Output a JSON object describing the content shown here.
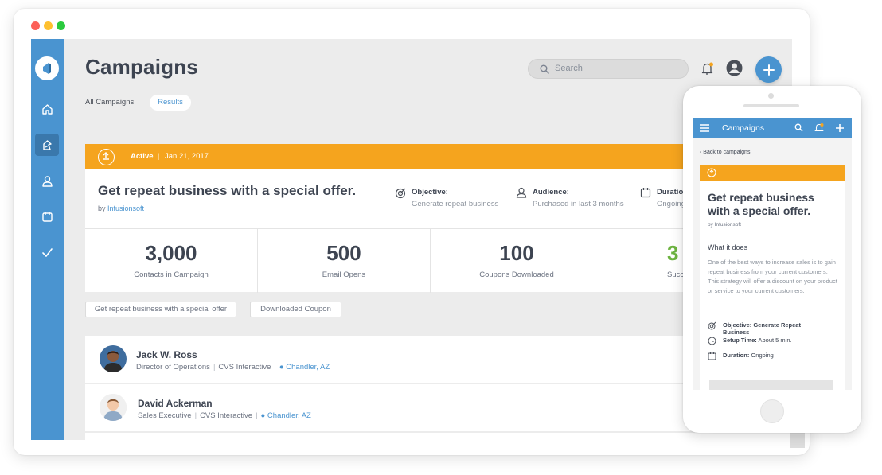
{
  "window": {
    "dots": [
      "#fc6058",
      "#fec02f",
      "#2aca3e"
    ]
  },
  "sidebar": {
    "items": [
      {
        "icon": "logo-icon"
      },
      {
        "icon": "home-icon"
      },
      {
        "icon": "campaign-icon",
        "active": true
      },
      {
        "icon": "contacts-icon"
      },
      {
        "icon": "calendar-icon"
      },
      {
        "icon": "checkmark-icon"
      }
    ],
    "accent": "#4a94d0"
  },
  "header": {
    "title": "Campaigns",
    "search_placeholder": "Search"
  },
  "tabs": [
    {
      "label": "All Campaigns",
      "active": false
    },
    {
      "label": "Results",
      "active": true
    }
  ],
  "campaign": {
    "status": "Active",
    "date": "Jan 21, 2017",
    "title": "Get repeat business with a special offer.",
    "by": "by",
    "author": "Infusionsoft",
    "objective_label": "Objective:",
    "objective_value": "Generate repeat business",
    "audience_label": "Audience:",
    "audience_value": "Purchased in last 3 months",
    "duration_label": "Duration",
    "duration_value": "Ongoing",
    "header_color": "#f5a41e"
  },
  "stats": [
    {
      "value": "3,000",
      "label": "Contacts in Campaign"
    },
    {
      "value": "500",
      "label": "Email Opens"
    },
    {
      "value": "100",
      "label": "Coupons Downloaded"
    },
    {
      "value": "3",
      "label": "Succ",
      "color": "#6cb33f"
    }
  ],
  "chips": [
    "Get repeat business with a special offer",
    "Downloaded Coupon"
  ],
  "contacts": [
    {
      "name": "Jack  W. Ross",
      "title": "Director of Operations",
      "company": "CVS Interactive",
      "location": "Chandler, AZ"
    },
    {
      "name": "David Ackerman",
      "title": "Sales Executive",
      "company": "CVS Interactive",
      "location": "Chandler, AZ"
    }
  ],
  "mobile": {
    "title": "Campaigns",
    "back": "Back to campaigns",
    "campaign_title": "Get repeat business with a special offer.",
    "by": "by",
    "author": "Infusionsoft",
    "what_heading": "What it does",
    "description": "One of the best ways to increase sales is to gain repeat business from your current customers. This strategy will offer a discount on your product or service to your current customers.",
    "objective_label": "Objective: Generate Repeat Business",
    "setup_label": "Setup Time:",
    "setup_value": "About 5 min.",
    "duration_label": "Duration:",
    "duration_value": "Ongoing"
  }
}
